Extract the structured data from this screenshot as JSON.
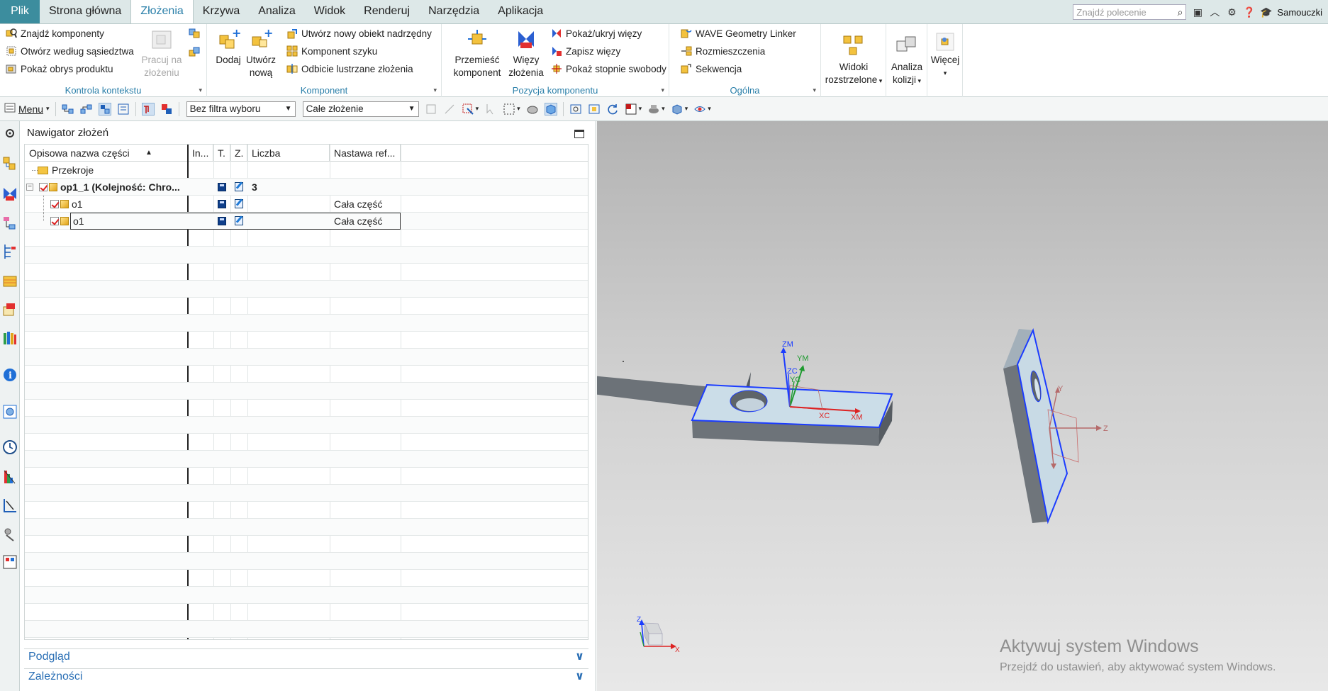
{
  "menu_tabs": [
    "Plik",
    "Strona główna",
    "Złożenia",
    "Krzywa",
    "Analiza",
    "Widok",
    "Renderuj",
    "Narzędzia",
    "Aplikacja"
  ],
  "active_tab": "Złożenia",
  "search": {
    "placeholder": "Znajdź polecenie"
  },
  "tutorials_label": "Samouczki",
  "ribbon": {
    "kontrola": {
      "label": "Kontrola kontekstu",
      "find_components": "Znajdź komponenty",
      "open_by_proximity": "Otwórz według sąsiedztwa",
      "show_product_outline": "Pokaż obrys produktu",
      "work_in_assembly_1": "Pracuj na",
      "work_in_assembly_2": "złożeniu"
    },
    "komponent": {
      "label": "Komponent",
      "add_1": "Dodaj",
      "create_new_1": "Utwórz",
      "create_new_2": "nową",
      "new_parent": "Utwórz nowy obiekt nadrzędny",
      "array_component": "Komponent szyku",
      "mirror_assembly": "Odbicie lustrzane złożenia"
    },
    "pozycja": {
      "label": "Pozycja komponentu",
      "move_1": "Przemieść",
      "move_2": "komponent",
      "constraints_1": "Więzy",
      "constraints_2": "złożenia",
      "show_hide_constraints": "Pokaż/ukryj więzy",
      "save_constraints": "Zapisz więzy",
      "show_dof": "Pokaż stopnie swobody"
    },
    "ogolna": {
      "label": "Ogólna",
      "wave_linker": "WAVE Geometry Linker",
      "arrangements": "Rozmieszczenia",
      "sequence": "Sekwencja"
    },
    "exploded_1": "Widoki",
    "exploded_2": "rozstrzelone",
    "clearance_1": "Analiza",
    "clearance_2": "kolizji",
    "more": "Więcej"
  },
  "toolbar": {
    "menu_label": "Menu",
    "filter_value": "Bez filtra wyboru",
    "scope_value": "Całe złożenie"
  },
  "navigator": {
    "title": "Nawigator złożeń",
    "columns": [
      "Opisowa nazwa części",
      "In...",
      "T.",
      "Z.",
      "Liczba",
      "Nastawa ref..."
    ],
    "rows": [
      {
        "name": "Przekroje",
        "count": "",
        "ref": ""
      },
      {
        "name": "op1_1 (Kolejność: Chro...",
        "count": "3",
        "ref": ""
      },
      {
        "name": "o1",
        "count": "",
        "ref": "Cała część"
      },
      {
        "name": "o1",
        "count": "",
        "ref": "Cała część"
      }
    ],
    "preview_label": "Podgląd",
    "dependencies_label": "Zależności"
  },
  "viewport": {
    "axis_labels": {
      "zm": "ZM",
      "ym": "YM",
      "zc": "ZC",
      "yc": "YC",
      "xc": "XC",
      "xm": "XM",
      "y": "Y",
      "z": "Z",
      "tz": "Z",
      "tx": "X"
    },
    "watermark_title": "Aktywuj system Windows",
    "watermark_sub": "Przejdź do ustawień, aby aktywować system Windows."
  },
  "colors": {
    "accent": "#2a7fa9",
    "file_tab": "#3c8d9e",
    "part_face": "#c9dbe6",
    "part_side": "#6c7278",
    "selection_edge": "#1b3cff"
  }
}
